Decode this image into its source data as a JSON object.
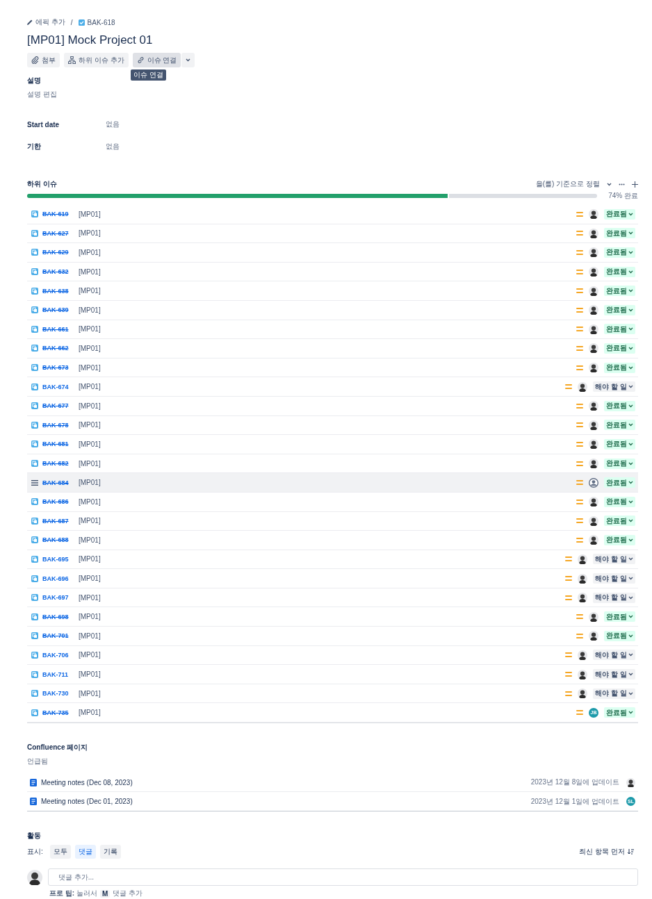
{
  "breadcrumb": {
    "epic": "에픽 추가",
    "separator": "/",
    "issue_key": "BAK-618"
  },
  "title": "[MP01] Mock Project 01",
  "toolbar": {
    "buttons": [
      {
        "kind": "attach",
        "label": "첨부"
      },
      {
        "kind": "subtask",
        "label": "하위 이슈 추가"
      },
      {
        "kind": "link",
        "label": "이슈 연결"
      }
    ],
    "tooltip": "이슈 연결"
  },
  "description": {
    "heading": "설명",
    "placeholder": "설명 편집"
  },
  "fields": [
    {
      "label": "Start date",
      "value": "없음"
    },
    {
      "label": "기한",
      "value": "없음"
    }
  ],
  "child_issues": {
    "heading": "하위 이슈",
    "sort_label": "을(를) 기준으로 정렬",
    "progress": {
      "level": 0.74,
      "label": "74% 완료"
    },
    "rows": [
      {
        "kind": "subtask",
        "key": "BAK-619",
        "done": true,
        "summary": "[MP01]",
        "highlighted": false,
        "assignee": {
          "kind": "photo"
        },
        "status": {
          "kind": "done",
          "label": "완료됨"
        }
      },
      {
        "kind": "subtask",
        "key": "BAK-627",
        "done": true,
        "summary": "[MP01]",
        "highlighted": false,
        "assignee": {
          "kind": "photo"
        },
        "status": {
          "kind": "done",
          "label": "완료됨"
        }
      },
      {
        "kind": "subtask",
        "key": "BAK-629",
        "done": true,
        "summary": "[MP01]",
        "highlighted": false,
        "assignee": {
          "kind": "photo"
        },
        "status": {
          "kind": "done",
          "label": "완료됨"
        }
      },
      {
        "kind": "subtask",
        "key": "BAK-632",
        "done": true,
        "summary": "[MP01]",
        "highlighted": false,
        "assignee": {
          "kind": "photo"
        },
        "status": {
          "kind": "done",
          "label": "완료됨"
        }
      },
      {
        "kind": "subtask",
        "key": "BAK-638",
        "done": true,
        "summary": "[MP01]",
        "highlighted": false,
        "assignee": {
          "kind": "photo"
        },
        "status": {
          "kind": "done",
          "label": "완료됨"
        }
      },
      {
        "kind": "subtask",
        "key": "BAK-639",
        "done": true,
        "summary": "[MP01]",
        "highlighted": false,
        "assignee": {
          "kind": "photo"
        },
        "status": {
          "kind": "done",
          "label": "완료됨"
        }
      },
      {
        "kind": "subtask",
        "key": "BAK-661",
        "done": true,
        "summary": "[MP01]",
        "highlighted": false,
        "assignee": {
          "kind": "photo"
        },
        "status": {
          "kind": "done",
          "label": "완료됨"
        }
      },
      {
        "kind": "subtask",
        "key": "BAK-662",
        "done": true,
        "summary": "[MP01]",
        "highlighted": false,
        "assignee": {
          "kind": "photo"
        },
        "status": {
          "kind": "done",
          "label": "완료됨"
        }
      },
      {
        "kind": "subtask",
        "key": "BAK-673",
        "done": true,
        "summary": "[MP01]",
        "highlighted": false,
        "assignee": {
          "kind": "photo"
        },
        "status": {
          "kind": "done",
          "label": "완료됨"
        }
      },
      {
        "kind": "subtask",
        "key": "BAK-674",
        "done": false,
        "summary": "[MP01]",
        "highlighted": false,
        "assignee": {
          "kind": "photo"
        },
        "status": {
          "kind": "todo",
          "label": "해야 할 일"
        }
      },
      {
        "kind": "subtask",
        "key": "BAK-677",
        "done": true,
        "summary": "[MP01]",
        "highlighted": false,
        "assignee": {
          "kind": "photo"
        },
        "status": {
          "kind": "done",
          "label": "완료됨"
        }
      },
      {
        "kind": "subtask",
        "key": "BAK-678",
        "done": true,
        "summary": "[MP01]",
        "highlighted": false,
        "assignee": {
          "kind": "photo"
        },
        "status": {
          "kind": "done",
          "label": "완료됨"
        }
      },
      {
        "kind": "subtask",
        "key": "BAK-681",
        "done": true,
        "summary": "[MP01]",
        "highlighted": false,
        "assignee": {
          "kind": "photo"
        },
        "status": {
          "kind": "done",
          "label": "완료됨"
        }
      },
      {
        "kind": "subtask",
        "key": "BAK-682",
        "done": true,
        "summary": "[MP01]",
        "highlighted": false,
        "assignee": {
          "kind": "photo"
        },
        "status": {
          "kind": "done",
          "label": "완료됨"
        }
      },
      {
        "kind": "drag",
        "key": "BAK-684",
        "done": true,
        "summary": "[MP01]",
        "highlighted": true,
        "assignee": {
          "kind": "default"
        },
        "status": {
          "kind": "done",
          "label": "완료됨"
        }
      },
      {
        "kind": "subtask",
        "key": "BAK-686",
        "done": true,
        "summary": "[MP01]",
        "highlighted": false,
        "assignee": {
          "kind": "photo"
        },
        "status": {
          "kind": "done",
          "label": "완료됨"
        }
      },
      {
        "kind": "subtask",
        "key": "BAK-687",
        "done": true,
        "summary": "[MP01]",
        "highlighted": false,
        "assignee": {
          "kind": "photo"
        },
        "status": {
          "kind": "done",
          "label": "완료됨"
        }
      },
      {
        "kind": "subtask",
        "key": "BAK-688",
        "done": true,
        "summary": "[MP01]",
        "highlighted": false,
        "assignee": {
          "kind": "photo"
        },
        "status": {
          "kind": "done",
          "label": "완료됨"
        }
      },
      {
        "kind": "subtask",
        "key": "BAK-695",
        "done": false,
        "summary": "[MP01]",
        "highlighted": false,
        "assignee": {
          "kind": "photo"
        },
        "status": {
          "kind": "todo",
          "label": "해야 할 일"
        }
      },
      {
        "kind": "subtask",
        "key": "BAK-696",
        "done": false,
        "summary": "[MP01]",
        "highlighted": false,
        "assignee": {
          "kind": "photo"
        },
        "status": {
          "kind": "todo",
          "label": "해야 할 일"
        }
      },
      {
        "kind": "subtask",
        "key": "BAK-697",
        "done": false,
        "summary": "[MP01]",
        "highlighted": false,
        "assignee": {
          "kind": "photo"
        },
        "status": {
          "kind": "todo",
          "label": "해야 할 일"
        }
      },
      {
        "kind": "subtask",
        "key": "BAK-698",
        "done": true,
        "summary": "[MP01]",
        "highlighted": false,
        "assignee": {
          "kind": "photo"
        },
        "status": {
          "kind": "done",
          "label": "완료됨"
        }
      },
      {
        "kind": "subtask",
        "key": "BAK-701",
        "done": true,
        "summary": "[MP01]",
        "highlighted": false,
        "assignee": {
          "kind": "photo"
        },
        "status": {
          "kind": "done",
          "label": "완료됨"
        }
      },
      {
        "kind": "subtask",
        "key": "BAK-706",
        "done": false,
        "summary": "[MP01]",
        "highlighted": false,
        "assignee": {
          "kind": "photo"
        },
        "status": {
          "kind": "todo",
          "label": "해야 할 일"
        }
      },
      {
        "kind": "subtask",
        "key": "BAK-711",
        "done": false,
        "summary": "[MP01]",
        "highlighted": false,
        "assignee": {
          "kind": "photo"
        },
        "status": {
          "kind": "todo",
          "label": "해야 할 일"
        }
      },
      {
        "kind": "subtask",
        "key": "BAK-730",
        "done": false,
        "summary": "[MP01]",
        "highlighted": false,
        "assignee": {
          "kind": "photo"
        },
        "status": {
          "kind": "todo",
          "label": "해야 할 일"
        }
      },
      {
        "kind": "subtask",
        "key": "BAK-735",
        "done": true,
        "summary": "[MP01]",
        "highlighted": false,
        "assignee": {
          "kind": "initials",
          "initials": "JB"
        },
        "status": {
          "kind": "done",
          "label": "완료됨"
        }
      }
    ]
  },
  "confluence": {
    "heading": "Confluence 페이지",
    "subheading": "언급됨",
    "pages": [
      {
        "title": "Meeting notes (Dec 08, 2023)",
        "updated": "2023년 12월 8일에 업데이트",
        "avatar": {
          "kind": "photo"
        }
      },
      {
        "title": "Meeting notes (Dec 01, 2023)",
        "updated": "2023년 12월 1일에 업데이트",
        "avatar": {
          "kind": "initials",
          "initials": "SL"
        }
      }
    ]
  },
  "activity": {
    "heading": "활동",
    "show_label": "표시:",
    "filters": [
      {
        "label": "모두",
        "selected": false
      },
      {
        "label": "댓글",
        "selected": true
      },
      {
        "label": "기록",
        "selected": false
      }
    ],
    "sort": "최신 항목 먼저",
    "comment_placeholder": "댓글 추가...",
    "tip_prefix": "프로 팁:",
    "tip_press": "눌러서",
    "tip_key": "M",
    "tip_suffix": "댓글 추가"
  }
}
